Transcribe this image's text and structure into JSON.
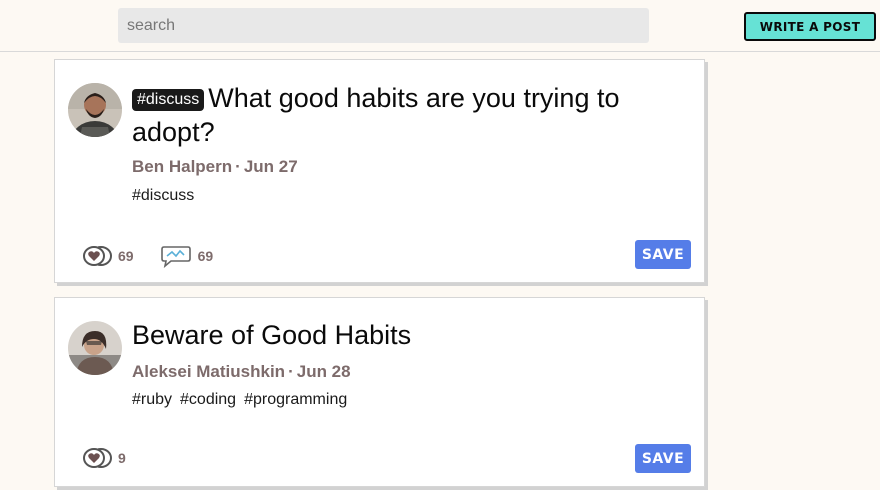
{
  "header": {
    "search_placeholder": "search",
    "write_button": "WRITE A POST"
  },
  "posts": [
    {
      "tag_pill": "#discuss",
      "title": "What good habits are you trying to adopt?",
      "author": "Ben Halpern",
      "separator": "·",
      "date": "Jun 27",
      "tags": [
        "#discuss"
      ],
      "reactions": "69",
      "comments": "69",
      "save_label": "SAVE"
    },
    {
      "title": "Beware of Good Habits",
      "author": "Aleksei Matiushkin",
      "separator": "·",
      "date": "Jun 28",
      "tags": [
        "#ruby",
        "#coding",
        "#programming"
      ],
      "reactions": "9",
      "save_label": "SAVE"
    }
  ],
  "colors": {
    "accent_button": "#66e2d5",
    "save_button": "#557de8",
    "meta_text": "#7d6b6b",
    "background": "#fdf9f3"
  }
}
